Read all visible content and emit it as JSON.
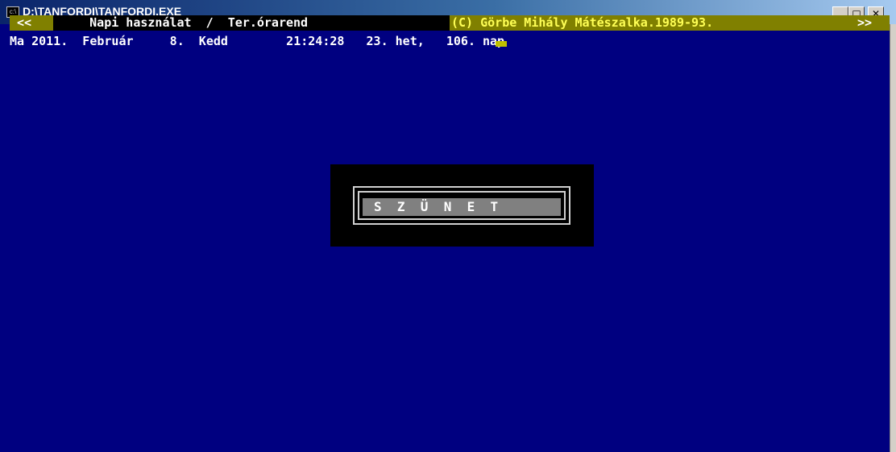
{
  "window": {
    "title": "D:\\TANFORDI\\TANFORDI.EXE",
    "icon_text": "c:\\",
    "minimize_label": "_",
    "maximize_label": "□",
    "close_label": "✕"
  },
  "menubar": {
    "left_arrows": " <<",
    "middle": "     Napi használat  /  Ter.órarend ",
    "copyright": "(C) Görbe Mihály Mátészalka.1989-93. ",
    "right_arrows": ">>"
  },
  "status": {
    "line": "Ma 2011.  Február     8.  Kedd        21:24:28   23. het,   106. nap"
  },
  "dialog": {
    "text": "S  Z  Ü  N  E  T"
  },
  "colors": {
    "console_bg": "#000080",
    "menubar_bg": "#808000",
    "copyright_fg": "#FFFF55",
    "dialog_bg": "#000000",
    "dialog_text_bg": "#808080"
  }
}
